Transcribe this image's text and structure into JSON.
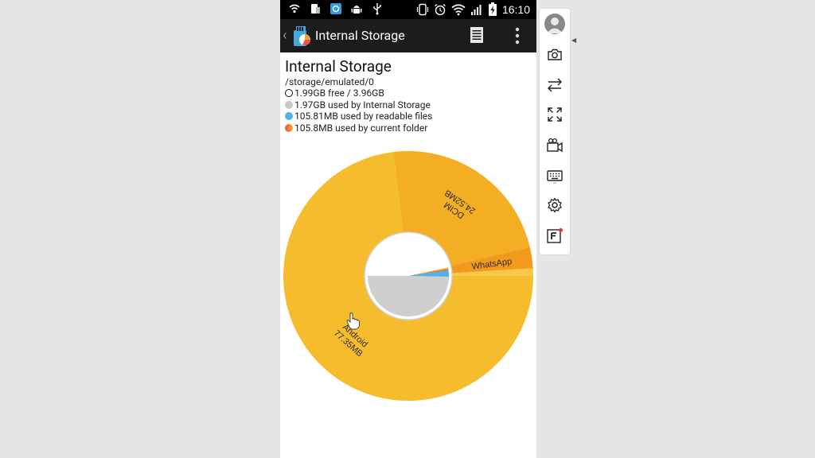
{
  "status_bar": {
    "time": "16:10"
  },
  "action_bar": {
    "title": "Internal Storage"
  },
  "header": {
    "title": "Internal Storage",
    "path": "/storage/emulated/0",
    "legend": [
      {
        "text": "1.99GB free / 3.96GB",
        "kind": "free"
      },
      {
        "text": "1.97GB used by Internal Storage",
        "kind": "internal"
      },
      {
        "text": "105.81MB used by readable files",
        "kind": "readable"
      },
      {
        "text": "105.8MB used by current folder",
        "kind": "folder"
      }
    ]
  },
  "chart_data": {
    "type": "pie",
    "title": "",
    "slices": [
      {
        "label": "Android",
        "value_label": "77.35MB",
        "value": 77.35,
        "color": "#f5bd2e"
      },
      {
        "label": "DCIM",
        "value_label": "24.52MB",
        "value": 24.52,
        "color": "#f3ae24"
      },
      {
        "label": "WhatsApp",
        "value_label": "",
        "value": 2.9,
        "color": "#f29a1e"
      },
      {
        "label": "",
        "value_label": "",
        "value": 1.03,
        "color": "#f7c84a"
      }
    ],
    "inner_ring": {
      "slices": [
        {
          "name": "Internal Storage",
          "fraction": 0.497,
          "color": "#cfcfcf"
        },
        {
          "name": "readable files",
          "fraction": 0.026,
          "color": "#4fb3e8"
        }
      ]
    }
  },
  "colors": {
    "status_bar": "#000000",
    "action_bar": "#1c1c1c",
    "background": "#e6e6e6"
  },
  "side_toolbar": {
    "tools": [
      "avatar",
      "camera-icon",
      "swap-icon",
      "fullscreen-icon",
      "video-camera-icon",
      "keyboard-icon",
      "settings-icon",
      "f-badge-icon"
    ]
  }
}
